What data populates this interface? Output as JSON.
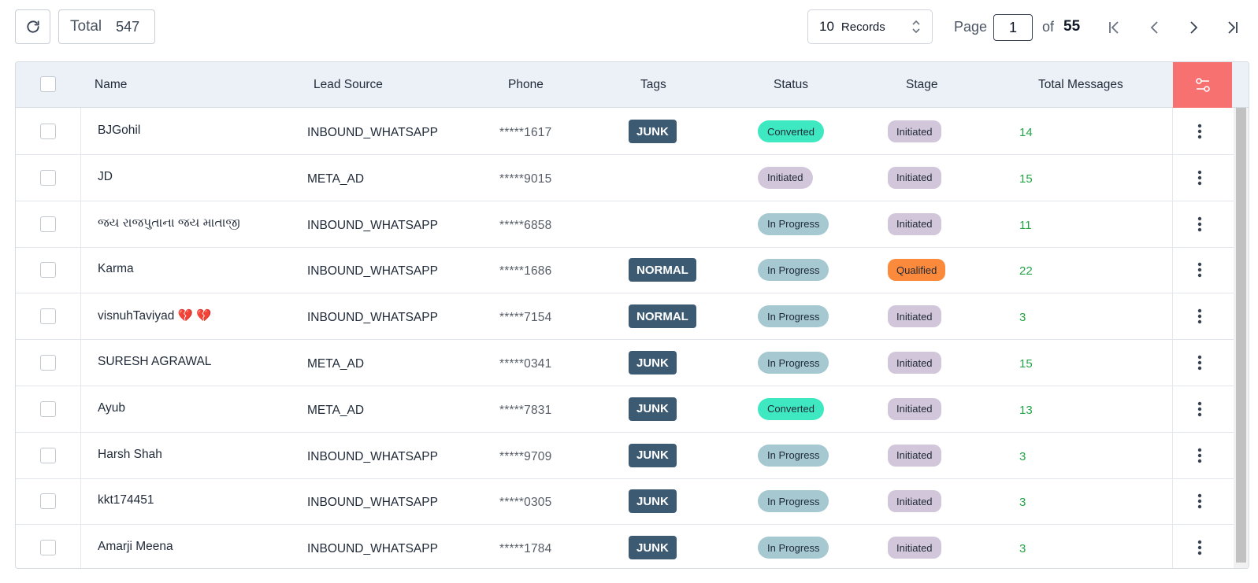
{
  "toolbar": {
    "total_label": "Total",
    "total_count": "547",
    "records_count": "10",
    "records_label": "Records",
    "page_label": "Page",
    "page_value": "1",
    "of_label": "of",
    "page_total": "55",
    "icons": [
      "refresh-icon",
      "chevron-updown-icon",
      "first-page-icon",
      "prev-page-icon",
      "next-page-icon",
      "last-page-icon"
    ]
  },
  "table": {
    "columns": [
      "Name",
      "Lead Source",
      "Phone",
      "Tags",
      "Status",
      "Stage",
      "Total Messages"
    ],
    "rows": [
      {
        "name": "BJGohil",
        "source": "INBOUND_WHATSAPP",
        "phone": "*****1617",
        "tag": "JUNK",
        "status": "Converted",
        "stage": "Initiated",
        "messages": "14"
      },
      {
        "name": "JD",
        "source": "META_AD",
        "phone": "*****9015",
        "tag": "",
        "status": "Initiated",
        "stage": "Initiated",
        "messages": "15"
      },
      {
        "name": "જય રાજપુતાના જય માતાજી",
        "source": "INBOUND_WHATSAPP",
        "phone": "*****6858",
        "tag": "",
        "status": "In Progress",
        "stage": "Initiated",
        "messages": "11"
      },
      {
        "name": "Karma",
        "source": "INBOUND_WHATSAPP",
        "phone": "*****1686",
        "tag": "NORMAL",
        "status": "In Progress",
        "stage": "Qualified",
        "messages": "22"
      },
      {
        "name": "visnuhTaviyad 💔 💔",
        "source": "INBOUND_WHATSAPP",
        "phone": "*****7154",
        "tag": "NORMAL",
        "status": "In Progress",
        "stage": "Initiated",
        "messages": "3"
      },
      {
        "name": "SURESH AGRAWAL",
        "source": "META_AD",
        "phone": "*****0341",
        "tag": "JUNK",
        "status": "In Progress",
        "stage": "Initiated",
        "messages": "15"
      },
      {
        "name": "Ayub",
        "source": "META_AD",
        "phone": "*****7831",
        "tag": "JUNK",
        "status": "Converted",
        "stage": "Initiated",
        "messages": "13"
      },
      {
        "name": "Harsh Shah",
        "source": "INBOUND_WHATSAPP",
        "phone": "*****9709",
        "tag": "JUNK",
        "status": "In Progress",
        "stage": "Initiated",
        "messages": "3"
      },
      {
        "name": "kkt174451",
        "source": "INBOUND_WHATSAPP",
        "phone": "*****0305",
        "tag": "JUNK",
        "status": "In Progress",
        "stage": "Initiated",
        "messages": "3"
      },
      {
        "name": "Amarji Meena",
        "source": "INBOUND_WHATSAPP",
        "phone": "*****1784",
        "tag": "JUNK",
        "status": "In Progress",
        "stage": "Initiated",
        "messages": "3"
      }
    ]
  },
  "colors": {
    "header_bg": "#ecf1f8",
    "filter_button": "#f87171",
    "tag_bg": "#3d5a73",
    "status_converted": "#3ee8c1",
    "status_in_progress": "#a5c8d1",
    "status_initiated": "#d2c6da",
    "stage_initiated": "#d2c6da",
    "stage_qualified": "#fb8a3c",
    "messages_text": "#22a447"
  }
}
